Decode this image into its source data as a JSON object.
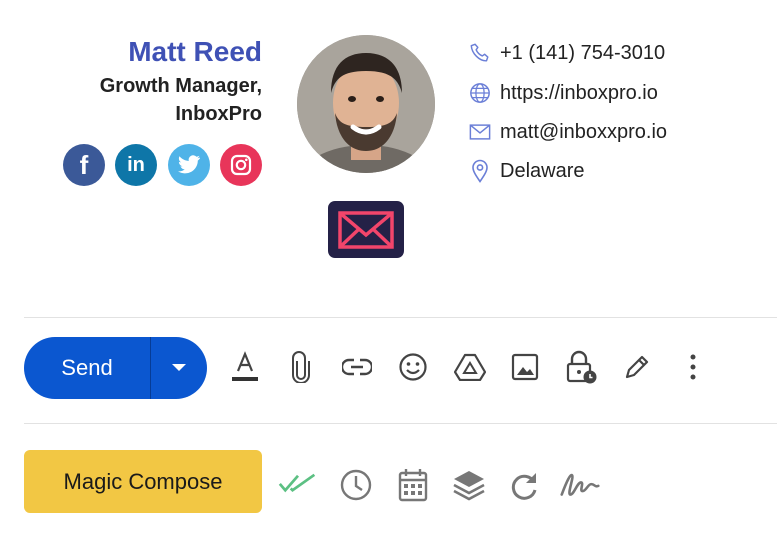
{
  "signature": {
    "name": "Matt Reed",
    "title_line1": "Growth Manager,",
    "title_line2": "InboxPro",
    "social": [
      "facebook-icon",
      "linkedin-icon",
      "twitter-icon",
      "instagram-icon"
    ],
    "linkedin_text": "in",
    "facebook_text": "f",
    "contacts": [
      {
        "icon": "phone-icon",
        "text": "+1 (141) 754-3010"
      },
      {
        "icon": "globe-icon",
        "text": "https://inboxpro.io"
      },
      {
        "icon": "mail-icon",
        "text": "matt@inboxxpro.io"
      },
      {
        "icon": "location-pin-icon",
        "text": "Delaware"
      }
    ],
    "colors": {
      "name": "#3f51b5",
      "badge_bg": "#242147",
      "badge_envelope": "#f2456b",
      "icon": "#6b7fd7"
    }
  },
  "toolbar": {
    "send_label": "Send",
    "send_color": "#0b57d0",
    "icons": [
      "text-format-icon",
      "attach-icon",
      "link-icon",
      "emoji-icon",
      "drive-icon",
      "image-icon",
      "confidential-lock-icon",
      "signature-pen-icon",
      "more-options-icon"
    ]
  },
  "bottom_bar": {
    "magic_compose_label": "Magic Compose",
    "magic_compose_color": "#f2c744",
    "icons": [
      "double-check-icon",
      "clock-icon",
      "calendar-icon",
      "layers-icon",
      "redo-icon",
      "signature-scribble-icon"
    ]
  }
}
